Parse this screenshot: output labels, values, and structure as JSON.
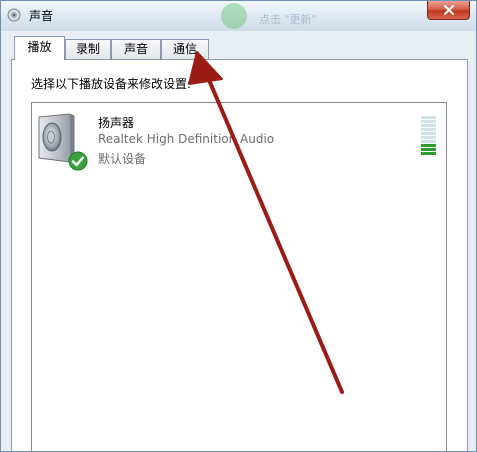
{
  "window": {
    "title": "声音",
    "close_icon": "close-icon",
    "background_title_glimpse": "点击 \"更新\""
  },
  "tabs": [
    {
      "label": "播放",
      "active": true
    },
    {
      "label": "录制",
      "active": false
    },
    {
      "label": "声音",
      "active": false
    },
    {
      "label": "通信",
      "active": false
    }
  ],
  "playback": {
    "instruction": "选择以下播放设备来修改设置:",
    "devices": [
      {
        "name": "扬声器",
        "description": "Realtek High Definition Audio",
        "status": "默认设备",
        "icon": "speaker-icon",
        "status_icon": "default-device-check-icon",
        "level_fraction": 0.25
      }
    ]
  },
  "annotation": {
    "type": "arrow",
    "color": "#9b1c14",
    "points_to": "tab-communications"
  }
}
